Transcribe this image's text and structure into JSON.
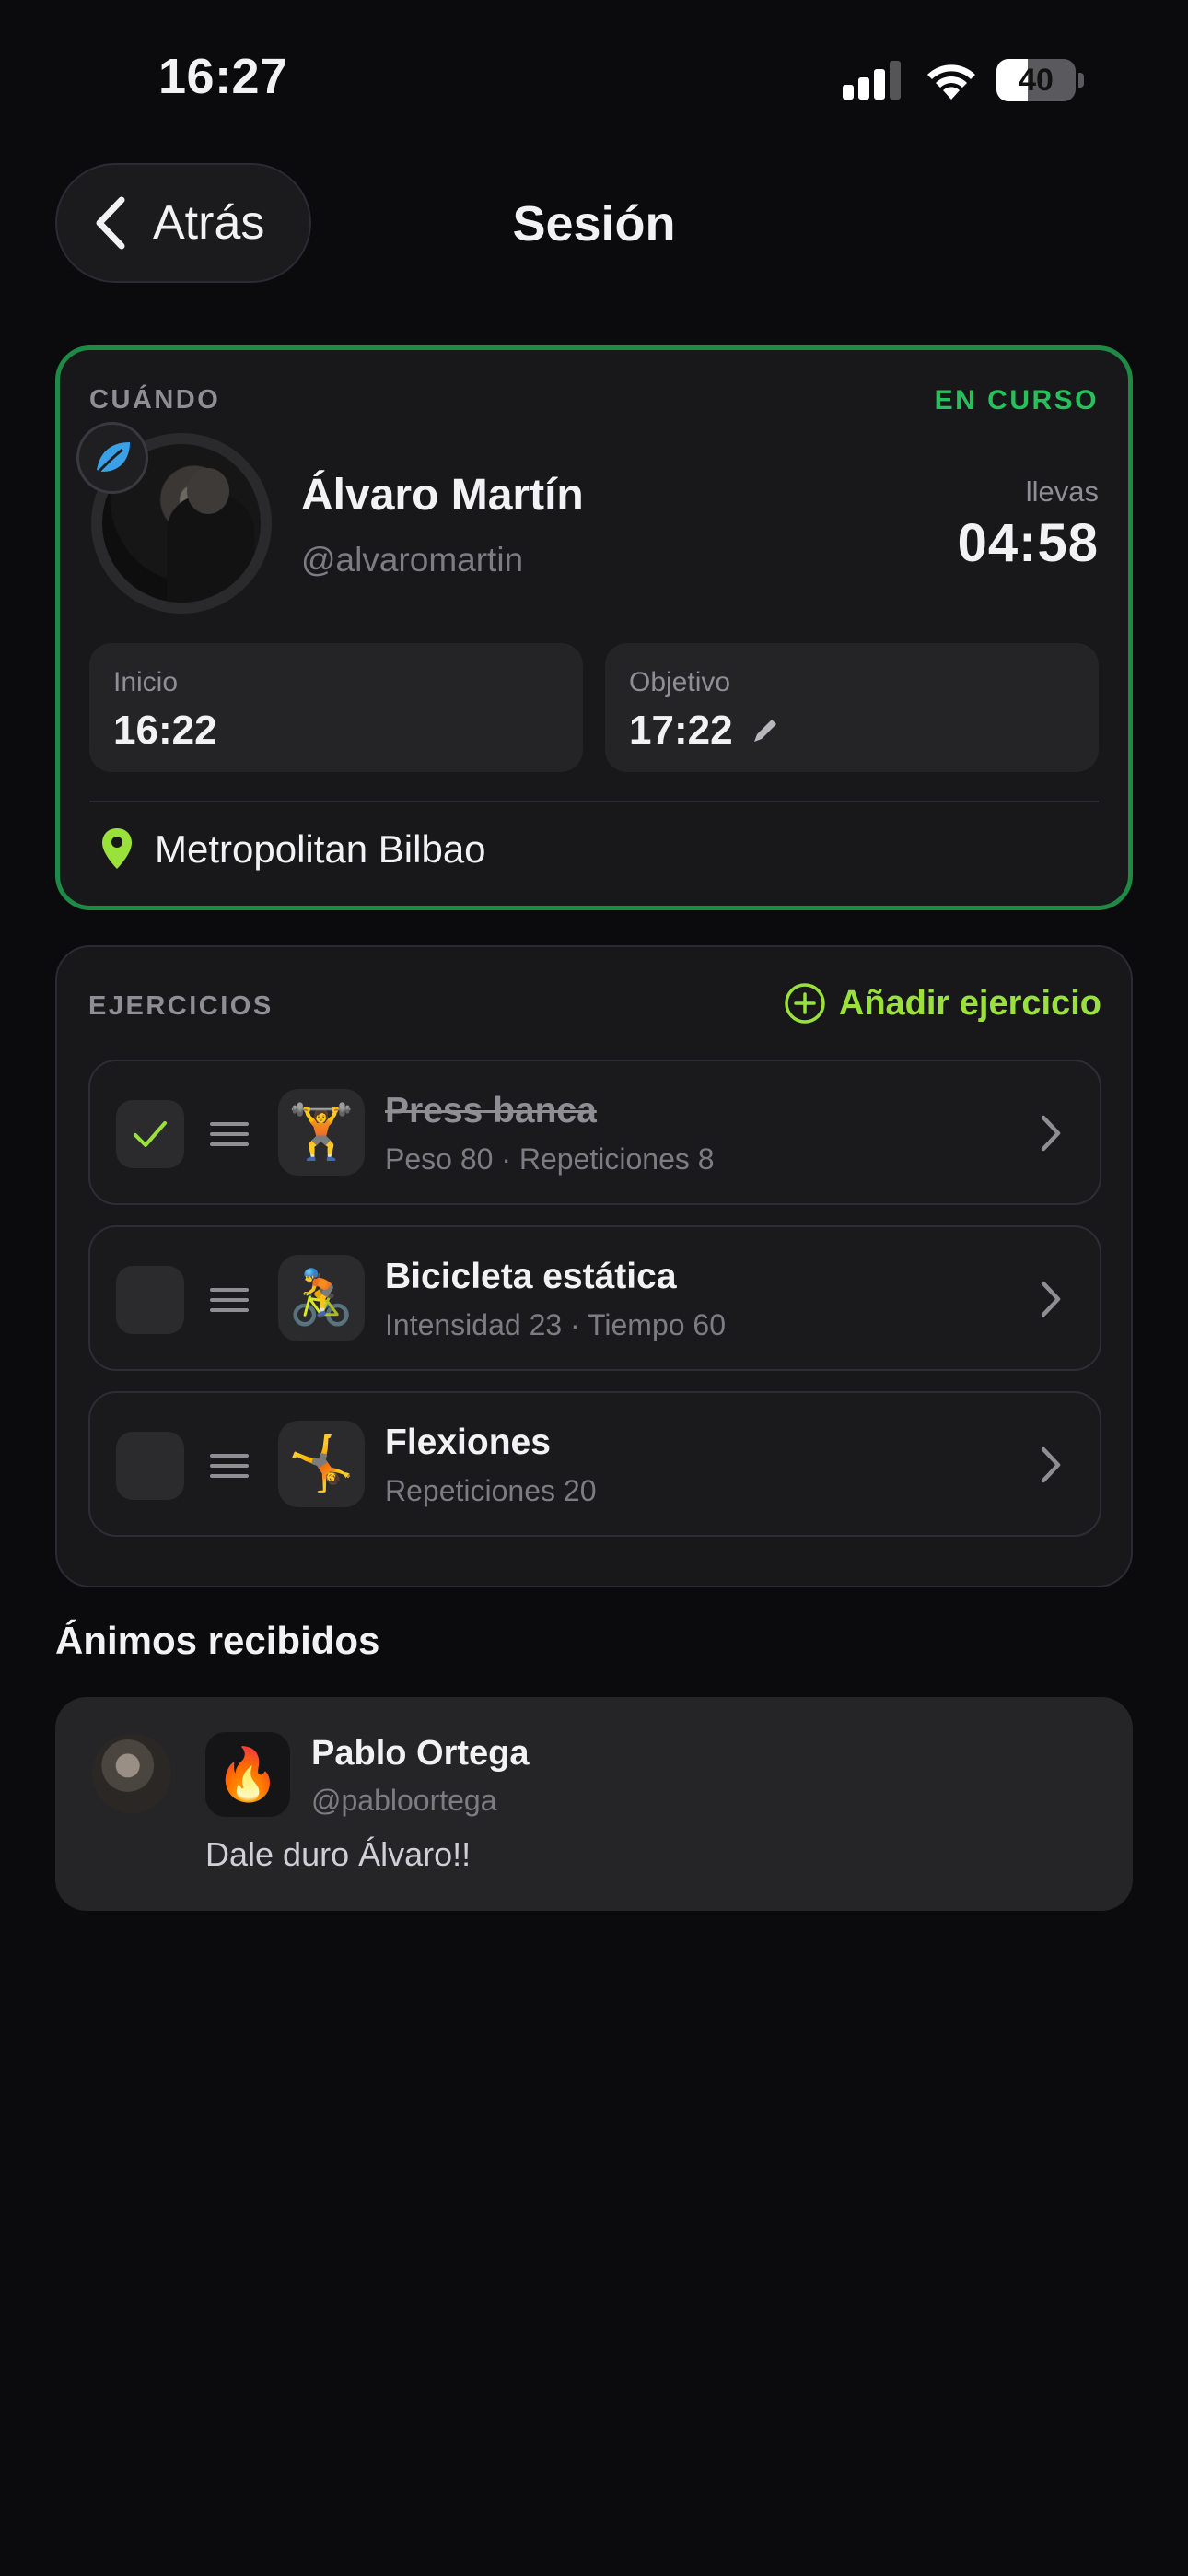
{
  "status_bar": {
    "time": "16:27",
    "battery_level": "40",
    "battery_fraction": 0.4
  },
  "header": {
    "back_label": "Atrás",
    "title": "Sesión"
  },
  "session": {
    "when_label": "CUÁNDO",
    "status": "EN CURSO",
    "user_name": "Álvaro Martín",
    "user_handle": "@alvaromartin",
    "elapsed_label": "llevas",
    "elapsed": "04:58",
    "start_label": "Inicio",
    "start_time": "16:22",
    "goal_label": "Objetivo",
    "goal_time": "17:22",
    "location": "Metropolitan Bilbao",
    "accent_color": "#1e8a45"
  },
  "exercises": {
    "label": "EJERCICIOS",
    "add_label": "Añadir ejercicio",
    "items": [
      {
        "name": "Press banca",
        "detail": "Peso 80 · Repeticiones 8",
        "emoji": "🏋️",
        "done": true
      },
      {
        "name": "Bicicleta estática",
        "detail": "Intensidad 23 · Tiempo 60",
        "emoji": "🚴",
        "done": false
      },
      {
        "name": "Flexiones",
        "detail": "Repeticiones 20",
        "emoji": "🤸",
        "done": false
      }
    ]
  },
  "cheers": {
    "title": "Ánimos recibidos",
    "items": [
      {
        "emoji": "🔥",
        "name": "Pablo Ortega",
        "handle": "@pabloortega",
        "message": "Dale duro Álvaro!!"
      }
    ]
  }
}
